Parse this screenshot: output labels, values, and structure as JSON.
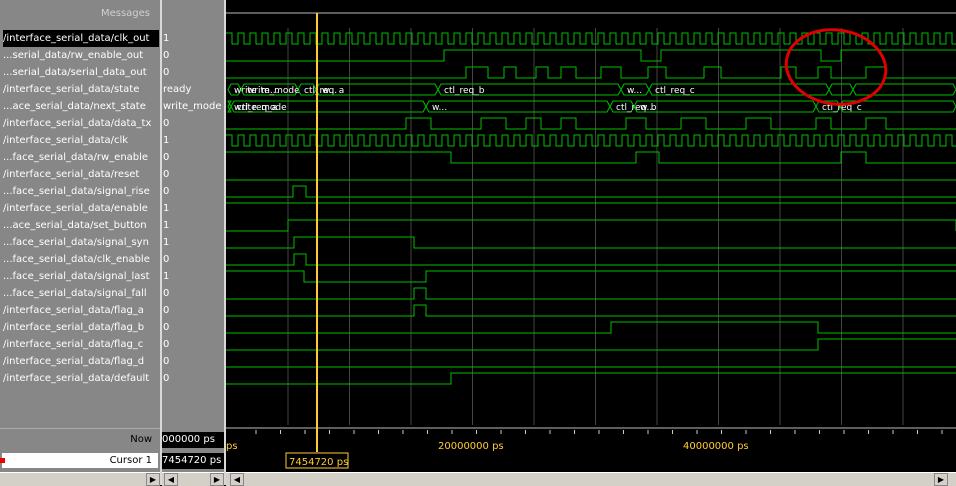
{
  "header": {
    "messages_label": "Messages"
  },
  "signals": [
    {
      "name": "/interface_serial_data/clk_out",
      "value": "1",
      "selected": true
    },
    {
      "name": "...serial_data/rw_enable_out",
      "value": "0"
    },
    {
      "name": "...serial_data/serial_data_out",
      "value": "0"
    },
    {
      "name": "/interface_serial_data/state",
      "value": "ready"
    },
    {
      "name": "...ace_serial_data/next_state",
      "value": "write_mode"
    },
    {
      "name": "/interface_serial_data/data_tx",
      "value": "0"
    },
    {
      "name": "/interface_serial_data/clk",
      "value": "1"
    },
    {
      "name": "...face_serial_data/rw_enable",
      "value": "0"
    },
    {
      "name": "/interface_serial_data/reset",
      "value": "0"
    },
    {
      "name": "...face_serial_data/signal_rise",
      "value": "0"
    },
    {
      "name": "/interface_serial_data/enable",
      "value": "1"
    },
    {
      "name": "...ace_serial_data/set_button",
      "value": "1"
    },
    {
      "name": "...face_serial_data/signal_syn",
      "value": "1"
    },
    {
      "name": "...face_serial_data/clk_enable",
      "value": "0"
    },
    {
      "name": "...face_serial_data/signal_last",
      "value": "1"
    },
    {
      "name": "...face_serial_data/signal_fall",
      "value": "0"
    },
    {
      "name": "/interface_serial_data/flag_a",
      "value": "0"
    },
    {
      "name": "/interface_serial_data/flag_b",
      "value": "0"
    },
    {
      "name": "/interface_serial_data/flag_c",
      "value": "0"
    },
    {
      "name": "/interface_serial_data/flag_d",
      "value": "0"
    },
    {
      "name": "/interface_serial_data/default",
      "value": "0"
    }
  ],
  "footer": {
    "now_label": "Now",
    "now_value": "000000 ps",
    "cursor_label": "Cursor 1",
    "cursor_value": "7454720 ps",
    "time_axis": [
      "ps",
      "20000000 ps",
      "40000000 ps"
    ],
    "cursor_readout": "7454720 ps"
  },
  "bus_labels": {
    "state": [
      "write_m...",
      "write_mode",
      "ctl_req_a",
      "w...",
      "ctl_req_b",
      "w...",
      "ctl_req_c"
    ],
    "next_state": [
      "write_mode",
      "ctl_req_a",
      "w...",
      "ctl_req_b",
      "w...",
      "ctl_req_c"
    ]
  },
  "colors": {
    "waveform": "#00c000",
    "cursor": "#ffcc33",
    "annotation": "#e00000",
    "grid": "#444444"
  }
}
